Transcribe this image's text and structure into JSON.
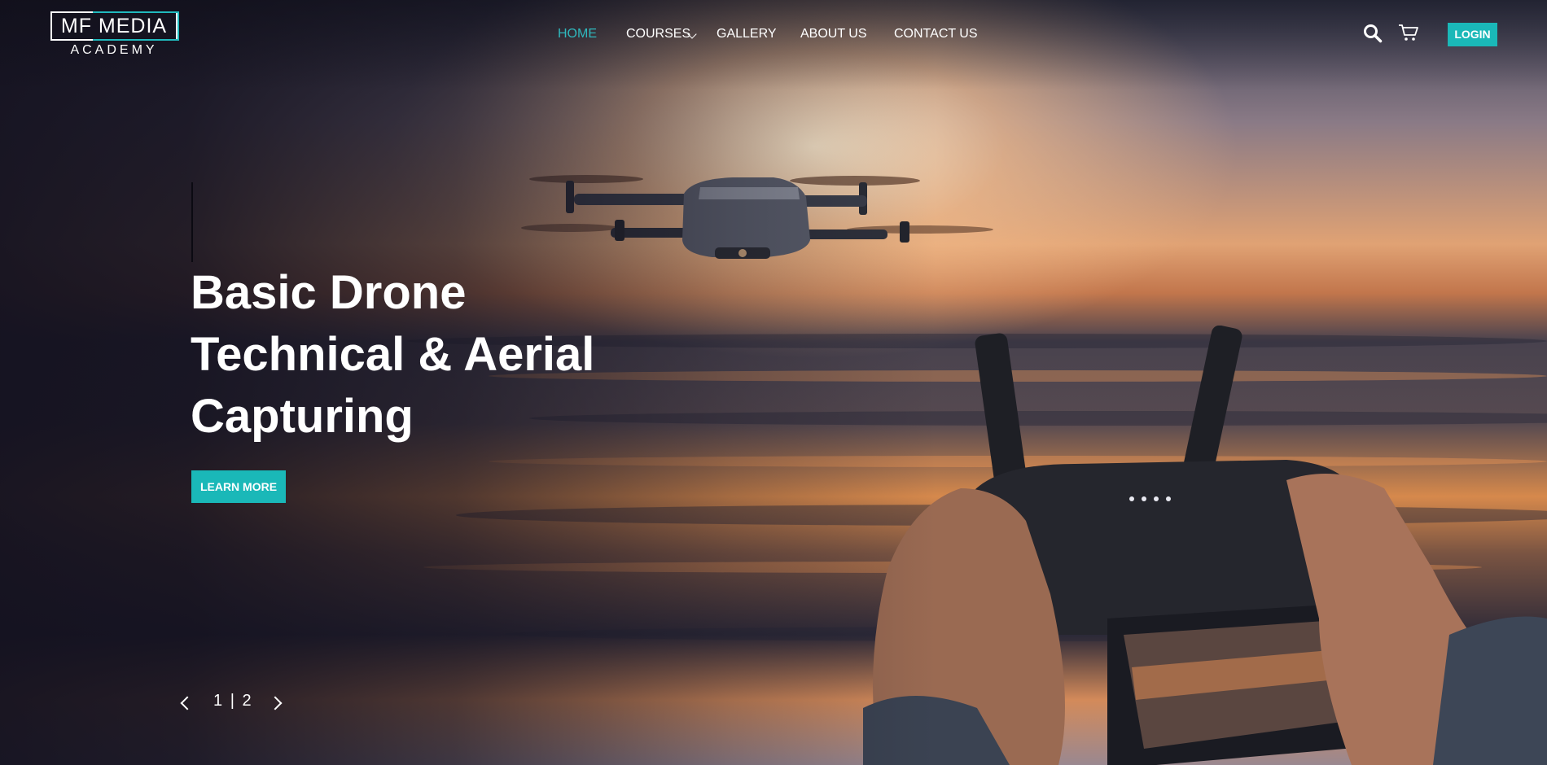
{
  "brand": {
    "logo_top": "MF MEDIA",
    "logo_bottom": "ACADEMY"
  },
  "nav": {
    "items": [
      {
        "label": "HOME",
        "active": true
      },
      {
        "label": "COURSES",
        "has_dropdown": true
      },
      {
        "label": "GALLERY"
      },
      {
        "label": "ABOUT US"
      },
      {
        "label": "CONTACT US"
      }
    ]
  },
  "header_actions": {
    "login_label": "LOGIN",
    "icons": [
      "search-icon",
      "cart-icon"
    ]
  },
  "hero": {
    "title_lines": [
      "Basic Drone",
      "Technical & Aerial",
      "Capturing"
    ],
    "cta_label": "LEARN MORE",
    "slider": {
      "current": "1",
      "separator": "|",
      "total": "2"
    }
  },
  "colors": {
    "accent": "#1ab8b8",
    "nav_active": "#2fb8bd",
    "text": "#ffffff",
    "overlay": "#15131f"
  }
}
